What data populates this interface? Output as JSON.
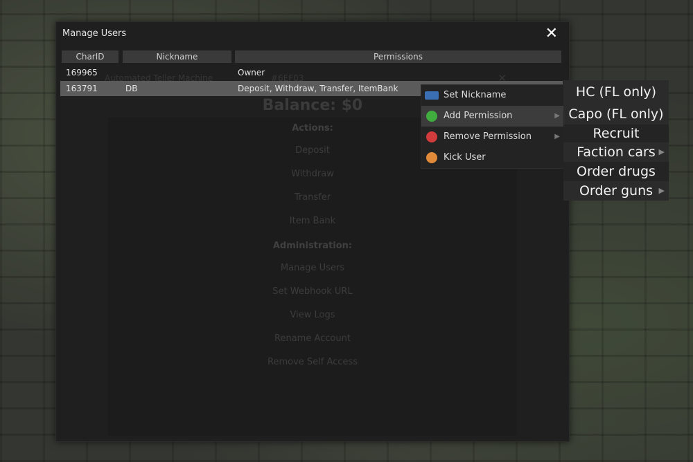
{
  "window": {
    "title": "Manage Users",
    "close_glyph": "✕"
  },
  "ghost": {
    "title": "Automated Teller Machine",
    "account": "#6EF03",
    "close_glyph": "✕",
    "balance": "Balance: $0",
    "actions_heading": "Actions:",
    "actions": [
      "Deposit",
      "Withdraw",
      "Transfer",
      "Item Bank"
    ],
    "admin_heading": "Administration:",
    "admin": [
      "Manage Users",
      "Set Webhook URL",
      "View Logs",
      "Rename Account",
      "Remove Self Access"
    ]
  },
  "table": {
    "columns": [
      "CharID",
      "Nickname",
      "Permissions"
    ],
    "rows": [
      {
        "charid": "169965",
        "nickname": "",
        "permissions": "Owner"
      },
      {
        "charid": "163791",
        "nickname": "DB",
        "permissions": "Deposit, Withdraw, Transfer, ItemBank"
      }
    ]
  },
  "context_menu": {
    "items": [
      {
        "label": "Set Nickname",
        "icon": "id-card-icon",
        "has_submenu": false
      },
      {
        "label": "Add Permission",
        "icon": "plus-circle-icon",
        "has_submenu": true
      },
      {
        "label": "Remove Permission",
        "icon": "minus-circle-icon",
        "has_submenu": true
      },
      {
        "label": "Kick User",
        "icon": "user-remove-icon",
        "has_submenu": false
      }
    ]
  },
  "submenu": {
    "items": [
      {
        "label": "HC (FL only)",
        "has_submenu": false
      },
      {
        "label": "Capo (FL only)",
        "has_submenu": false
      },
      {
        "label": "Recruit",
        "has_submenu": false
      },
      {
        "label": "Faction cars",
        "has_submenu": true
      },
      {
        "label": "Order drugs",
        "has_submenu": false
      },
      {
        "label": "Order guns",
        "has_submenu": true
      }
    ]
  },
  "colors": {
    "window_bg": "#1f1f1f",
    "header_bg": "#3a3a3a",
    "selected_row": "#5b5b5b",
    "add_icon": "#3fae3f",
    "remove_icon": "#d23b3b"
  }
}
